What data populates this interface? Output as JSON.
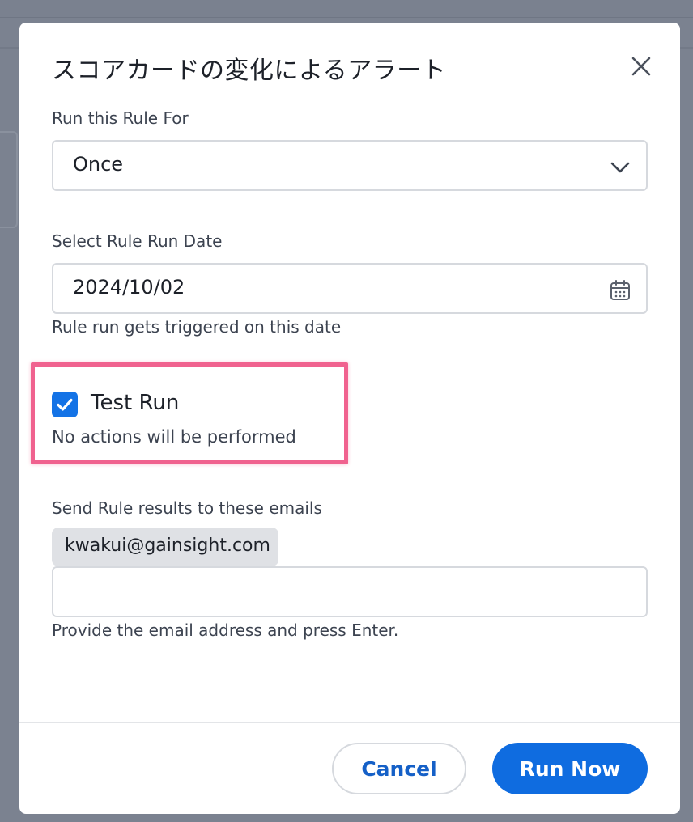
{
  "modal": {
    "title": "スコアカードの変化によるアラート"
  },
  "run_for": {
    "label": "Run this Rule For",
    "selected": "Once"
  },
  "run_date": {
    "label": "Select Rule Run Date",
    "value": "2024/10/02",
    "help": "Rule run gets triggered on this date"
  },
  "test_run": {
    "checked": true,
    "label": "Test Run",
    "description": "No actions will be performed"
  },
  "emails": {
    "label": "Send Rule results to these emails",
    "chips": [
      "kwakui@gainsight.com"
    ],
    "input_value": "",
    "help": "Provide the email address and press Enter."
  },
  "footer": {
    "cancel_label": "Cancel",
    "run_label": "Run Now"
  },
  "colors": {
    "primary": "#0f6ce0",
    "highlight": "#f0628f",
    "chip_bg": "#dfe1e5"
  },
  "icons": {
    "close": "close-icon",
    "dropdown": "chevron-down-icon",
    "calendar": "calendar-icon",
    "checkmark": "checkmark-icon"
  }
}
